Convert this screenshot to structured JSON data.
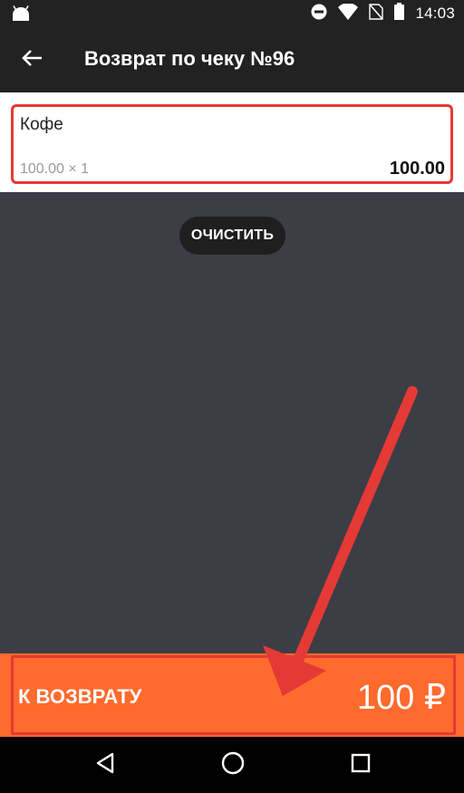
{
  "status_bar": {
    "time": "14:03",
    "icons": [
      "android-icon",
      "dnd-icon",
      "wifi-icon",
      "no-sim-icon",
      "battery-icon"
    ]
  },
  "app_bar": {
    "title": "Возврат по чеку №96",
    "back_icon": "arrow-left-icon"
  },
  "item": {
    "name": "Кофе",
    "qty": "100.00 × 1",
    "sum": "100.00"
  },
  "clear_button": "ОЧИСТИТЬ",
  "footer": {
    "label": "К ВОЗВРАТУ",
    "amount": "100 ₽"
  },
  "nav": [
    "back-icon",
    "home-icon",
    "recents-icon"
  ],
  "colors": {
    "app_bar": "#222222",
    "content_bg": "#3d3d46",
    "accent": "#ff6a2d",
    "highlight": "#e53935"
  }
}
